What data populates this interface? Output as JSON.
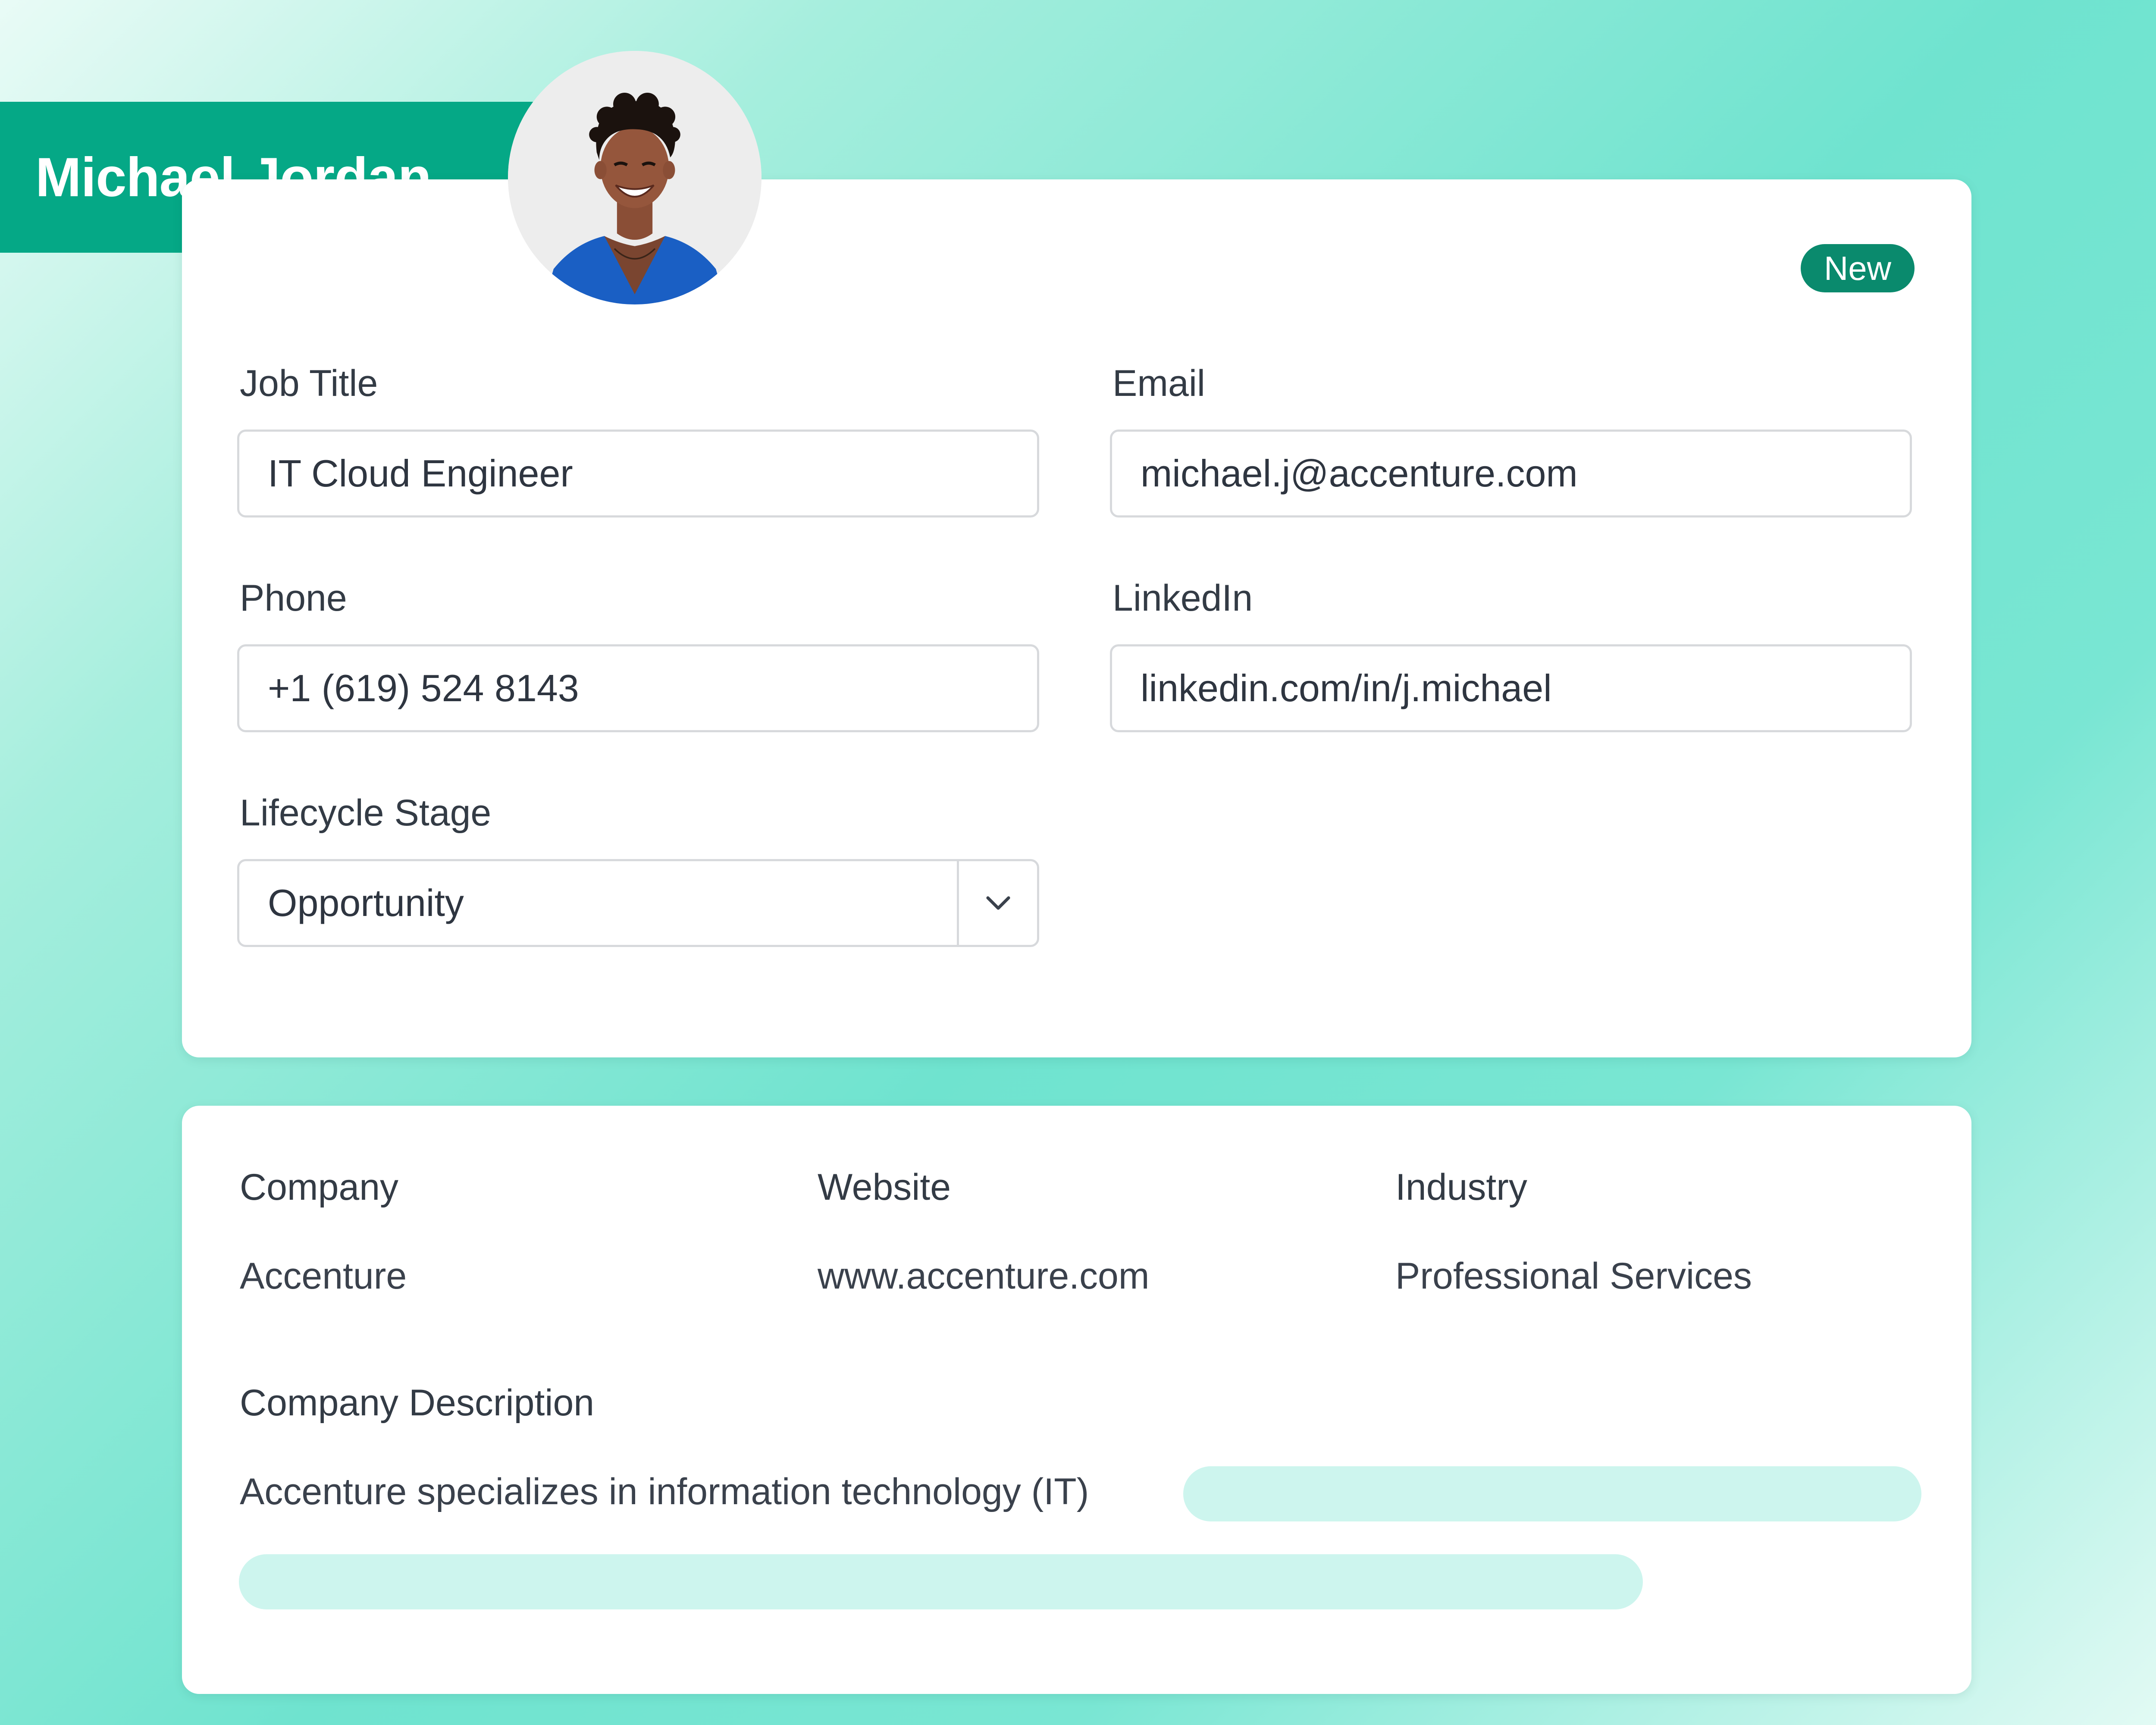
{
  "profile": {
    "name": "Michael Jordan",
    "badge": "New",
    "avatar_icon": "person-photo"
  },
  "contact_fields": {
    "job_title": {
      "label": "Job Title",
      "value": "IT Cloud Engineer"
    },
    "email": {
      "label": "Email",
      "value": "michael.j@accenture.com"
    },
    "phone": {
      "label": "Phone",
      "value": "+1 (619) 524 8143"
    },
    "linkedin": {
      "label": "LinkedIn",
      "value": "linkedin.com/in/j.michael"
    },
    "lifecycle_stage": {
      "label": "Lifecycle Stage",
      "value": "Opportunity",
      "icon": "chevron-down-icon"
    }
  },
  "company": {
    "company": {
      "label": "Company",
      "value": "Accenture"
    },
    "website": {
      "label": "Website",
      "value": "www.accenture.com"
    },
    "industry": {
      "label": "Industry",
      "value": "Professional Services"
    },
    "description": {
      "label": "Company Description",
      "value": "Accenture specializes in information technology (IT)"
    }
  },
  "colors": {
    "brand_green": "#05a886",
    "badge_green": "#0a8a6d",
    "placeholder_mint": "#cdf5ee"
  }
}
